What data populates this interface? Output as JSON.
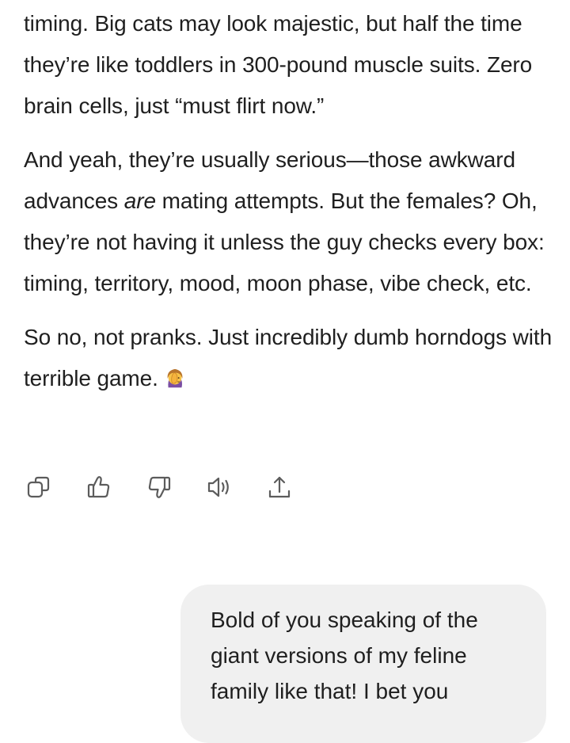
{
  "assistant": {
    "paragraph1": "timing. Big cats may look majestic, but half the time they’re like toddlers in 300-pound muscle suits. Zero brain cells, just “must flirt now.”",
    "paragraph2_before": "And yeah, they’re usually serious—those awkward advances ",
    "paragraph2_emphasis": "are",
    "paragraph2_after": " mating attempts. But the females? Oh, they’re not having it unless the guy checks every box: timing, territory, mood, moon phase, vibe check, etc.",
    "paragraph3": "So no, not pranks. Just incredibly dumb horndogs with terrible game.",
    "paragraph3_emoji": "person-facepalming-emoji"
  },
  "actions": [
    {
      "icon": "copy-icon"
    },
    {
      "icon": "thumbs-up-icon"
    },
    {
      "icon": "thumbs-down-icon"
    },
    {
      "icon": "speaker-icon"
    },
    {
      "icon": "share-icon"
    }
  ],
  "user_message": {
    "text": "Bold of you speaking of the giant versions of my feline family like that! I bet you"
  },
  "colors": {
    "text": "#1f1f1f",
    "icon": "#5c5c5c",
    "bubble": "#f0f0f0"
  }
}
